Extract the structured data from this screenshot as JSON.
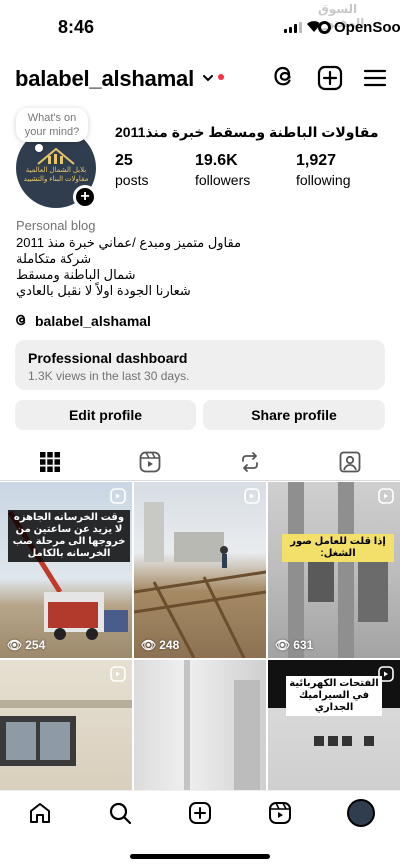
{
  "status_bar": {
    "time": "8:46",
    "watermark": "السوق المفتوح",
    "brand": "OpenSooq"
  },
  "header": {
    "username": "balabel_alshamal",
    "icons": [
      "threads-icon",
      "new-post-icon",
      "menu-icon"
    ],
    "unread_dot_color": "#ff3040"
  },
  "profile": {
    "note": "What's on your mind?",
    "display_name": "مقاولات الباطنة ومسقط خبرة منذ2011",
    "avatar_text": "بلابل الشمال العالمية مقاولات البناء والتشييد",
    "stats": [
      {
        "value": "25",
        "label": "posts"
      },
      {
        "value": "19.6K",
        "label": "followers"
      },
      {
        "value": "1,927",
        "label": "following"
      }
    ],
    "category": "Personal blog",
    "bio_lines": [
      "مقاول متميز ومبدع /عماني خبرة منذ 2011",
      "شركة متكاملة",
      "شمال الباطنة ومسقط",
      "شعارنا الجودة اولاً لا نقبل بالعادي"
    ],
    "threads_handle": "balabel_alshamal"
  },
  "dashboard": {
    "title": "Professional dashboard",
    "subtitle": "1.3K views in the last 30 days."
  },
  "buttons": {
    "edit": "Edit profile",
    "share": "Share profile"
  },
  "tabs": [
    "grid-icon",
    "reels-icon",
    "reposts-icon",
    "tagged-icon"
  ],
  "posts": [
    {
      "caption": "وقت الخرسانه الجاهزه لا يزيد عن ساعتين من خروجها الى مرحلة صب الخرسانه بالكامل",
      "views": "254"
    },
    {
      "caption": "",
      "views": "248"
    },
    {
      "caption": "إذا قلت للعامل صور الشغل:",
      "views": "631"
    },
    {
      "caption": "",
      "views": ""
    },
    {
      "caption": "",
      "views": ""
    },
    {
      "caption": "الفتحات الكهربائية في السيراميك الجداري",
      "views": ""
    }
  ],
  "bottom_nav": [
    "home-icon",
    "search-icon",
    "create-icon",
    "reels-nav-icon",
    "profile-avatar-icon"
  ]
}
